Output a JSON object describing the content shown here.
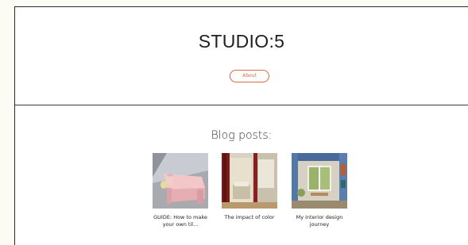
{
  "site": {
    "title": "STUDIO:5",
    "about_label": "About"
  },
  "blog": {
    "heading": "Blog posts:",
    "posts": [
      {
        "title": "GUIDE: How to make your own til...",
        "image_icon": "pink-bench-photo"
      },
      {
        "title": "The impact of color",
        "image_icon": "red-doorway-photo"
      },
      {
        "title": "My interior design journey",
        "image_icon": "blue-window-room-photo"
      }
    ]
  },
  "colors": {
    "background": "#fdfcf4",
    "accent": "#e0683a"
  }
}
